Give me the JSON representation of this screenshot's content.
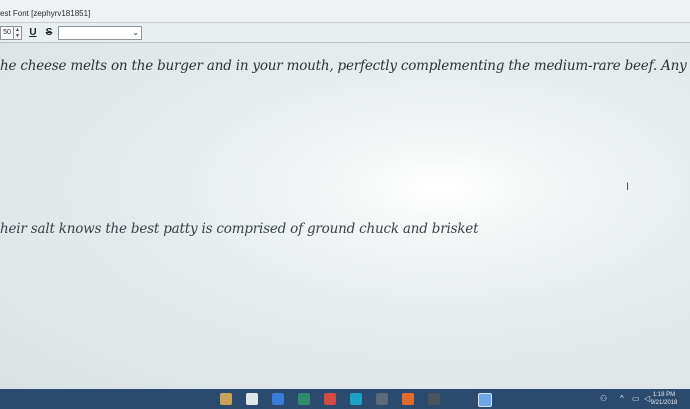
{
  "window": {
    "title": "est Font [zephyrv181851]"
  },
  "toolbar": {
    "font_size": "50",
    "underline_label": "U",
    "strike_label": "S",
    "font_select_value": ""
  },
  "document": {
    "line1": "he cheese melts on the burger and in your mouth, perfectly complementing the medium-rare beef. Any burger lover wor",
    "line2": "heir salt knows the best patty is comprised of ground chuck and brisket"
  },
  "taskbar": {
    "clock_time": "1:18 PM",
    "clock_date": "9/21/2018",
    "app_icons": [
      "file-explorer-icon",
      "store-icon",
      "mail-icon",
      "browser-icon",
      "app-icon",
      "app-icon",
      "app-icon",
      "app-icon",
      "app-icon",
      "active-app-icon"
    ],
    "colors": {
      "taskbar": "#2a4a6e",
      "accent": "#3a7bd5"
    }
  }
}
